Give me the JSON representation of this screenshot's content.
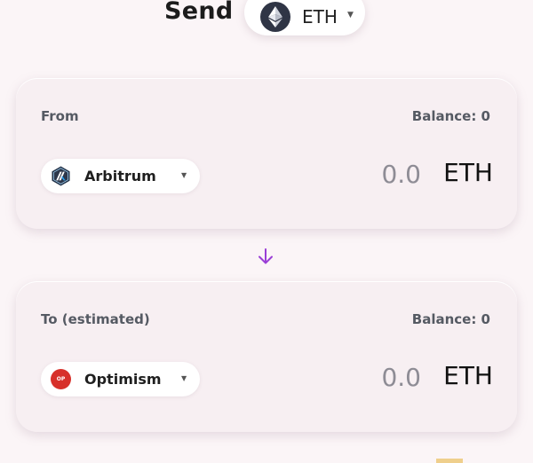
{
  "header": {
    "title": "Send",
    "token": {
      "symbol": "ETH",
      "icon": "ethereum-icon"
    }
  },
  "from": {
    "label": "From",
    "balance": "Balance: 0",
    "chain": {
      "name": "Arbitrum",
      "icon": "arbitrum-icon"
    },
    "amount": "0.0",
    "token": "ETH"
  },
  "swap_arrow": {
    "icon": "arrow-down-icon",
    "color": "#9a3fd6"
  },
  "to": {
    "label": "To (estimated)",
    "balance": "Balance: 0",
    "chain": {
      "name": "Optimism",
      "icon": "optimism-icon",
      "badge": "OP",
      "color": "#d7302a"
    },
    "amount": "0.0",
    "token": "ETH"
  }
}
